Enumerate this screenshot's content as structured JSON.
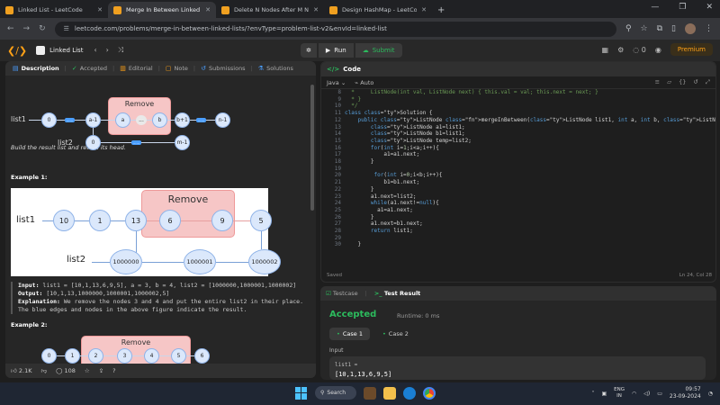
{
  "browser": {
    "tabs": [
      {
        "title": "Linked List - LeetCode",
        "active": false
      },
      {
        "title": "Merge In Between Linked Lists",
        "active": true
      },
      {
        "title": "Delete N Nodes After M Nodes",
        "active": false
      },
      {
        "title": "Design HashMap - LeetCode",
        "active": false
      }
    ],
    "new_tab": "+",
    "url": "leetcode.com/problems/merge-in-between-linked-lists/?envType=problem-list-v2&envId=linked-list"
  },
  "leetcode": {
    "problem_list": "Linked List",
    "run_label": "Run",
    "submit_label": "Submit",
    "streak": "0",
    "premium_label": "Premium"
  },
  "left_tabs": {
    "description": "Description",
    "accepted": "Accepted",
    "editorial": "Editorial",
    "note": "Note",
    "submissions": "Submissions",
    "solutions": "Solutions"
  },
  "diagram1": {
    "remove_label": "Remove",
    "list1_label": "list1",
    "list2_label": "list2",
    "nodes": {
      "n0": "0",
      "a_minus_1": "a-1",
      "a": "a",
      "dots": "...",
      "b": "b",
      "b_plus_1": "b+1",
      "n_minus_1": "n-1",
      "l2_0": "0",
      "m_minus_1": "m-1"
    },
    "ellipsis": "......"
  },
  "description_text": "Build the result list and return its head.",
  "example1": {
    "heading": "Example 1:",
    "image": {
      "remove_label": "Remove",
      "list1_label": "list1",
      "list2_label": "list2",
      "list1_nodes": [
        "10",
        "1",
        "13",
        "6",
        "9",
        "5"
      ],
      "list2_nodes": [
        "1000000",
        "1000001",
        "1000002"
      ]
    },
    "input_label": "Input:",
    "input_value": "list1 = [10,1,13,6,9,5], a = 3, b = 4, list2 = [1000000,1000001,1000002]",
    "output_label": "Output:",
    "output_value": "[10,1,13,1000000,1000001,1000002,5]",
    "explanation_label": "Explanation:",
    "explanation_value": "We remove the nodes 3 and 4 and put the entire list2 in their place. The blue edges and nodes in the above figure indicate the result."
  },
  "example2": {
    "heading": "Example 2:",
    "remove_label": "Remove",
    "nodes": [
      "0",
      "1",
      "2",
      "3",
      "4",
      "5",
      "6"
    ]
  },
  "left_footer": {
    "likes": "2.1K",
    "comments": "108"
  },
  "editor": {
    "title": "Code",
    "language": "Java",
    "mode": "Auto",
    "lines": [
      {
        "n": "8",
        "text": "  *     ListNode(int val, ListNode next) { this.val = val; this.next = next; }"
      },
      {
        "n": "9",
        "text": "  * }"
      },
      {
        "n": "10",
        "text": "  */"
      },
      {
        "n": "11",
        "text": "class Solution {"
      },
      {
        "n": "12",
        "text": "    public ListNode mergeInBetween(ListNode list1, int a, int b, ListNode list2) {"
      },
      {
        "n": "13",
        "text": "        ListNode a1=list1;"
      },
      {
        "n": "14",
        "text": "        ListNode b1=list1;"
      },
      {
        "n": "15",
        "text": "        ListNode temp=list2;"
      },
      {
        "n": "16",
        "text": "        for(int i=1;i<a;i++){"
      },
      {
        "n": "17",
        "text": "            a1=a1.next;"
      },
      {
        "n": "18",
        "text": "        }"
      },
      {
        "n": "19",
        "text": ""
      },
      {
        "n": "20",
        "text": "         for(int i=0;i<b;i++){"
      },
      {
        "n": "21",
        "text": "            b1=b1.next;"
      },
      {
        "n": "22",
        "text": "        }"
      },
      {
        "n": "23",
        "text": "        a1.next=list2;"
      },
      {
        "n": "24",
        "text": "        while(a1.next!=null){"
      },
      {
        "n": "25",
        "text": "          a1=a1.next;"
      },
      {
        "n": "26",
        "text": "        }"
      },
      {
        "n": "27",
        "text": "        a1.next=b1.next;"
      },
      {
        "n": "28",
        "text": "        return list1;"
      },
      {
        "n": "29",
        "text": ""
      },
      {
        "n": "30",
        "text": "    }"
      }
    ],
    "saved_label": "Saved",
    "cursor_pos": "Ln 24, Col 28"
  },
  "testpane": {
    "testcase_tab": "Testcase",
    "result_tab": "Test Result",
    "status": "Accepted",
    "runtime": "Runtime: 0 ms",
    "case1": "Case 1",
    "case2": "Case 2",
    "input_label": "Input",
    "var_label": "list1 =",
    "var_value": "[10,1,13,6,9,5]"
  },
  "taskbar": {
    "search_label": "Search",
    "lang_top": "ENG",
    "lang_bottom": "IN",
    "time": "09:57",
    "date": "23-09-2024"
  },
  "colors": {
    "accent_green": "#2cbb5d",
    "leetcode_orange": "#ffa116",
    "node_fill": "#dbe8fb"
  }
}
